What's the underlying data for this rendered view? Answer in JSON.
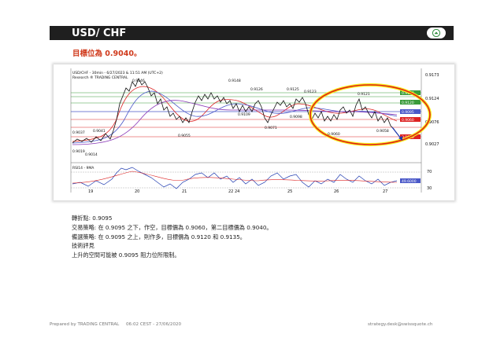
{
  "header": {
    "title": "USD/ CHF"
  },
  "target_text": "目標位為 0.9040。",
  "chart": {
    "title_line1": "USD/CHF - 30min - 6/27/2023 & 11:51 AM (UTC+2)",
    "title_line2": "Research ® TRADING CENTRAL",
    "right_axis": [
      "0.9173",
      "0.9124",
      "0.9076",
      "0.9027"
    ],
    "price_tags": [
      "0.9147",
      "0.9135",
      "0.9120",
      "0.9095",
      "0.9081",
      "0.9060",
      "0.9040"
    ],
    "annotations": [
      "0.9146",
      "0.9148",
      "0.9126",
      "0.9125",
      "0.9123",
      "0.9121",
      "0.9097",
      "0.9095",
      "0.9109",
      "0.9098",
      "0.9071",
      "0.9060",
      "0.9055",
      "0.9058",
      "0.9014",
      "0.9041",
      "0.9019",
      "0.9037",
      "0.9056"
    ],
    "rsi_label": "RSI14 - 9MA",
    "rsi_axis": [
      "70",
      "30"
    ],
    "rsi_value": "49.6000",
    "x_labels": [
      "19",
      "20",
      "21",
      "22 24",
      "25",
      "26",
      "27"
    ]
  },
  "analysis": {
    "pivot": "轉折點: 0.9095",
    "strategy": "交易策略: 在 0.9095 之下，作空，目標價為 0.9060，第二目標價為 0.9040。",
    "alternative": "備選策略: 在 0.9095 之上，則作多，目標價為 0.9120 和 0.9135。",
    "tech_heading": "技術評見",
    "tech_comment": "上升的空間可能被 0.9095 阻力位所限制。"
  },
  "footer": {
    "prepared_by": "Prepared by TRADING CENTRAL",
    "datetime": "06:02 CEST - 27/06/2020",
    "email": "strategy.desk@swissquote.ch"
  },
  "colors": {
    "header_bg": "#1f1f1f",
    "accent": "#d03a1c",
    "ellipse_outer": "#f7f016",
    "ellipse_inner": "#e0201c",
    "button": "#2e8b3c"
  }
}
